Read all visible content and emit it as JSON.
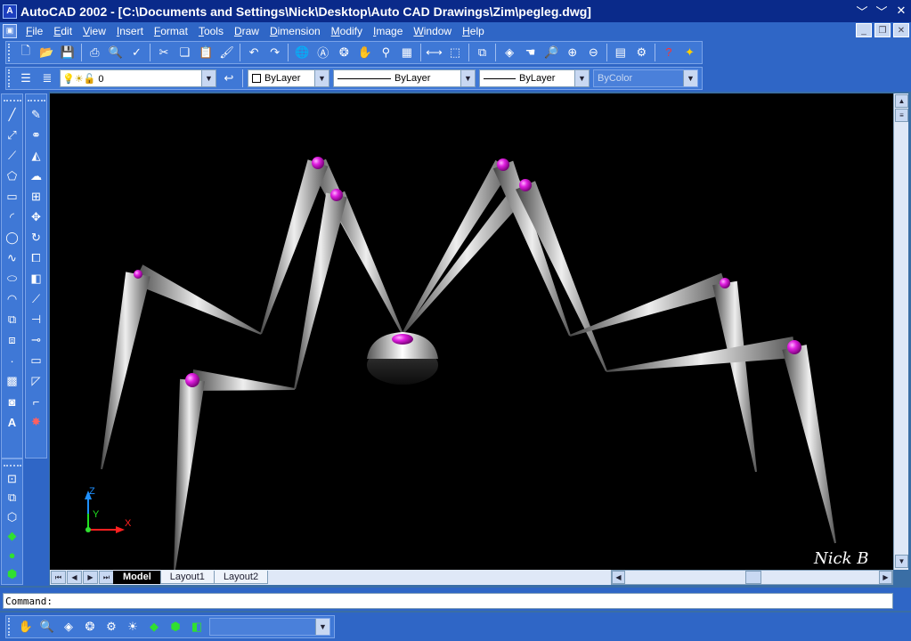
{
  "window": {
    "title": "AutoCAD 2002 - [C:\\Documents and Settings\\Nick\\Desktop\\Auto CAD Drawings\\Zim\\pegleg.dwg]",
    "controls": [
      "﹀",
      "﹀",
      "✕"
    ]
  },
  "menu": {
    "items": [
      "File",
      "Edit",
      "View",
      "Insert",
      "Format",
      "Tools",
      "Draw",
      "Dimension",
      "Modify",
      "Image",
      "Window",
      "Help"
    ]
  },
  "standard_toolbar": {
    "icons": [
      "new-icon",
      "open-icon",
      "save-icon",
      "print-icon",
      "print-preview-icon",
      "spelling-icon",
      "cut-icon",
      "copy-icon",
      "paste-icon",
      "match-properties-icon",
      "undo-icon",
      "redo-icon",
      "hyperlink-icon",
      "shade-icon",
      "orbit-icon",
      "pan-icon",
      "zoom-icon",
      "measure-icon",
      "distance-icon",
      "named-views-icon",
      "tile-icon",
      "properties-icon",
      "design-center-icon",
      "help-icon",
      "today-icon"
    ]
  },
  "layers_toolbar": {
    "layer_value": "0",
    "color_value": "ByLayer",
    "linetype_value": "ByLayer",
    "lineweight_value": "ByLayer",
    "plotstyle_value": "ByColor"
  },
  "draw_tools": [
    "line",
    "construction-line",
    "polyline",
    "polygon",
    "rectangle",
    "arc",
    "circle",
    "spline",
    "ellipse",
    "ellipse-arc",
    "insert-block",
    "make-block",
    "point",
    "hatch",
    "region",
    "text"
  ],
  "modify_tools": [
    "erase",
    "copy",
    "mirror",
    "offset",
    "array",
    "move",
    "rotate",
    "scale",
    "stretch",
    "trim",
    "extend",
    "break",
    "chamfer",
    "fillet",
    "explode"
  ],
  "view_tools": [
    "named-views",
    "render",
    "3d-orbit",
    "box",
    "sphere",
    "wedge"
  ],
  "viewport": {
    "background": "#000000",
    "leg_color": "#bfbfbf",
    "joint_color": "#e020e0",
    "ucs_labels": {
      "z": "Z",
      "y": "Y",
      "x": "X"
    },
    "signature": "Nick B"
  },
  "tabs": {
    "items": [
      "Model",
      "Layout1",
      "Layout2"
    ],
    "active": "Model"
  },
  "command_line": {
    "prompt": "Command:"
  },
  "bottom_toolbar": {
    "icons": [
      "pan-icon",
      "zoom-icon",
      "3d-orbit-icon",
      "continuous-orbit-icon",
      "render-icon",
      "light-icon",
      "scene-icon",
      "material-icon",
      "landscape-icon"
    ],
    "combo_value": ""
  }
}
